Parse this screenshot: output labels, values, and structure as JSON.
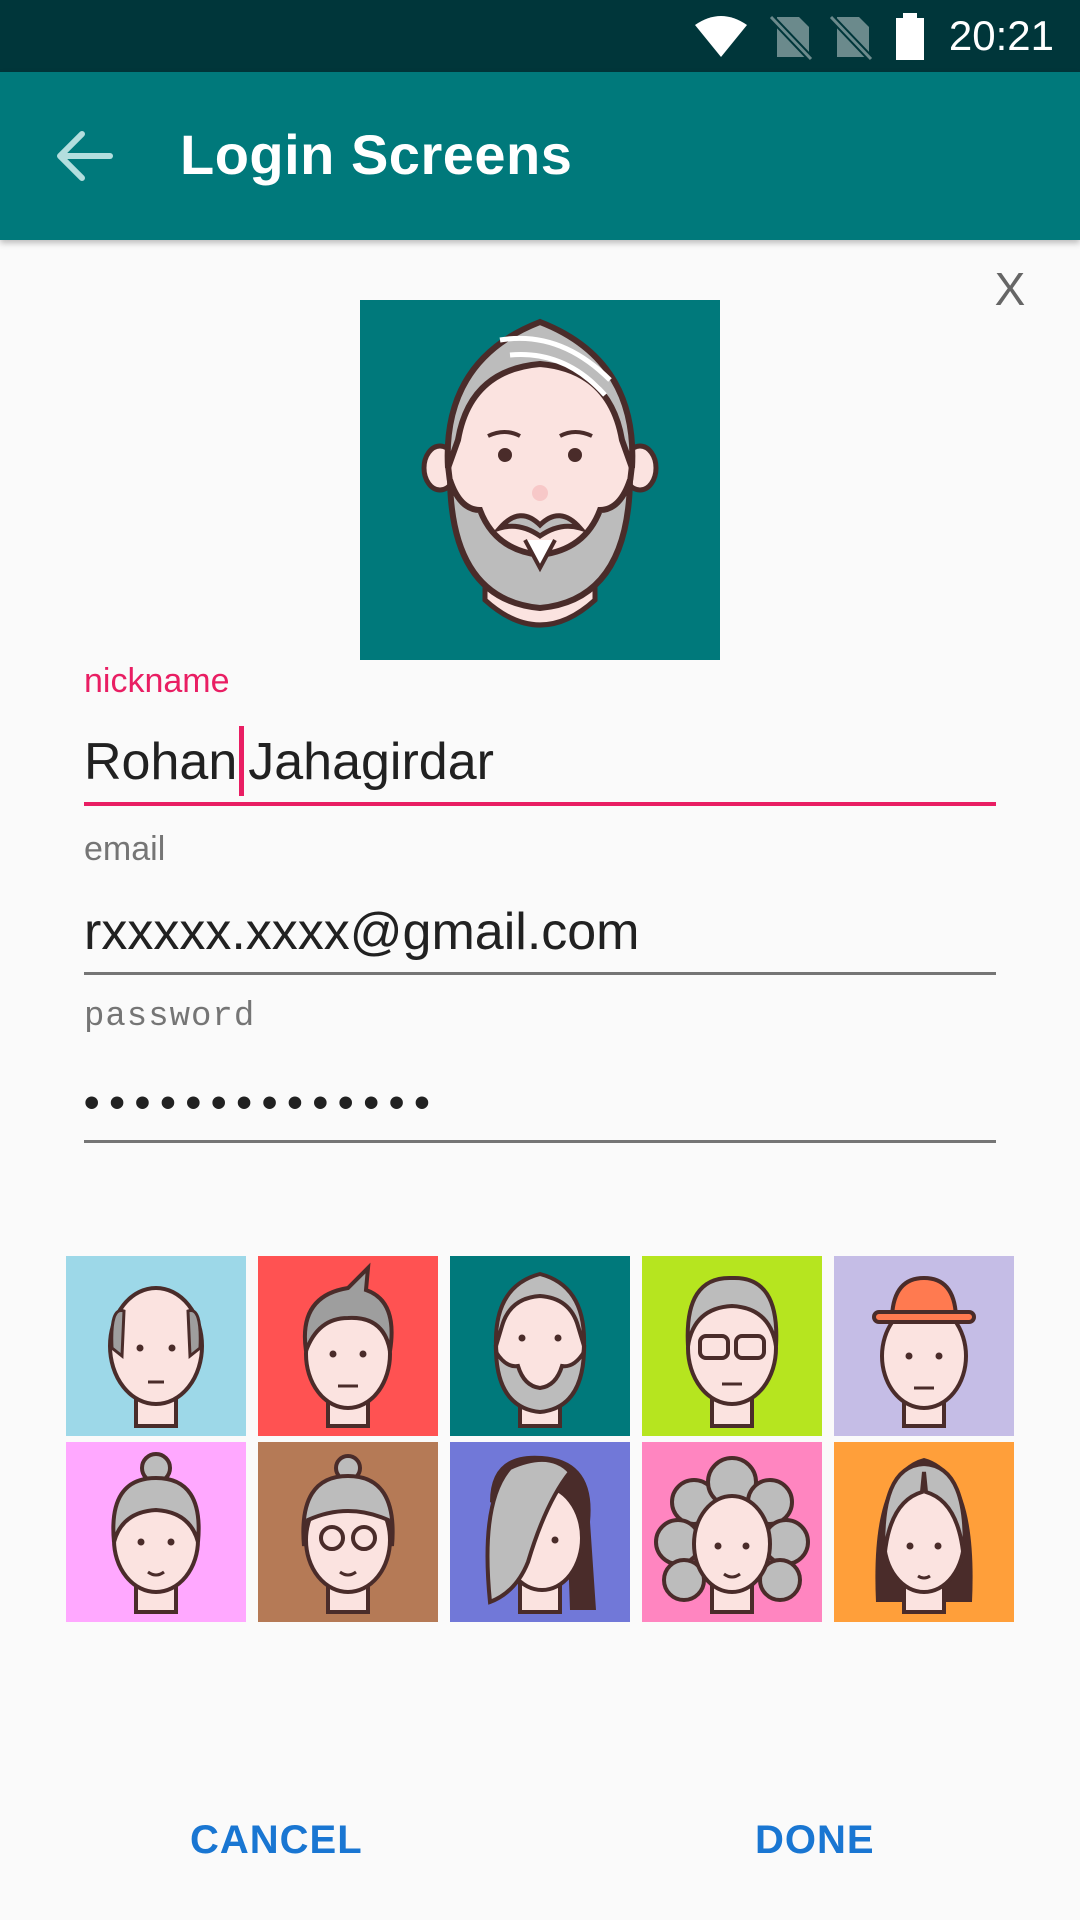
{
  "status_bar": {
    "time": "20:21"
  },
  "app_bar": {
    "title": "Login Screens"
  },
  "dialog": {
    "close_label": "X",
    "fields": {
      "nickname": {
        "label": "nickname",
        "value_before_cursor": "Rohan",
        "value_after_cursor": "Jahagirdar"
      },
      "email": {
        "label": "email",
        "value": "rxxxxx.xxxx@gmail.com"
      },
      "password": {
        "label": "password",
        "value": "••••••••••••••"
      }
    },
    "avatars": [
      {
        "name": "bald-man",
        "bg": "#9dd8e8"
      },
      {
        "name": "spiky-hair-man",
        "bg": "#ff5252"
      },
      {
        "name": "bearded-man",
        "bg": "#00797b"
      },
      {
        "name": "glasses-man",
        "bg": "#b6e51f"
      },
      {
        "name": "hat-man",
        "bg": "#c5bde6"
      },
      {
        "name": "bun-woman",
        "bg": "#ffa8ff"
      },
      {
        "name": "glasses-woman",
        "bg": "#b57a56"
      },
      {
        "name": "long-hair-woman",
        "bg": "#7178d8"
      },
      {
        "name": "curly-hair-woman",
        "bg": "#ff85c0"
      },
      {
        "name": "straight-hair-woman",
        "bg": "#ff9f3a"
      }
    ],
    "selected_avatar": "bearded-man",
    "cancel_label": "CANCEL",
    "done_label": "DONE"
  },
  "colors": {
    "accent": "#e91e63",
    "primary": "#00797b",
    "button": "#1976d2"
  }
}
